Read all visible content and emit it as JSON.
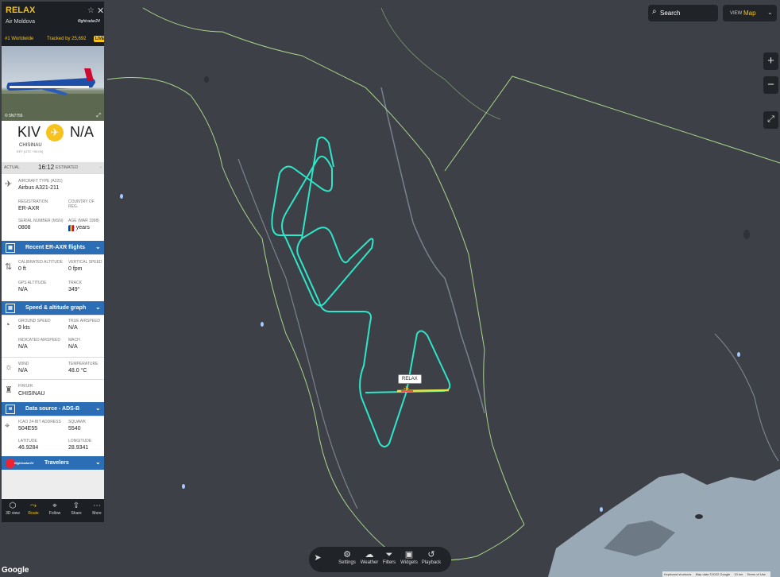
{
  "panel": {
    "callsign": "RELAX",
    "airline": "Air Moldova",
    "brand": "flightradar24",
    "rank": "#1 Worldwide",
    "tracked": "Tracked by 25,692",
    "live_badge": "LIVE",
    "photo_credit": "© 5N7756",
    "origin_code": "KIV",
    "dest_code": "N/A",
    "origin_city": "CHISINAU",
    "origin_tz": "EET (UTC +02:00)",
    "actual_label": "ACTUAL",
    "actual_time": "16:12",
    "estimated_label": "ESTIMATED",
    "estimated_value": "-",
    "aircraft_type_label": "AIRCRAFT TYPE (A321)",
    "aircraft_type": "Airbus A321-211",
    "registration_label": "REGISTRATION",
    "registration": "ER-AXR",
    "country_label": "COUNTRY OF REG.",
    "serial_label": "SERIAL NUMBER (MSN)",
    "serial": "0808",
    "age_label": "AGE (MAR 1998)",
    "age": "23 years",
    "recent_flights": "Recent ER-AXR flights",
    "cal_alt_label": "CALIBRATED ALTITUDE",
    "cal_alt": "0 ft",
    "vspeed_label": "VERTICAL SPEED",
    "vspeed": "0 fpm",
    "gps_alt_label": "GPS ALTITUDE",
    "gps_alt": "N/A",
    "track_label": "TRACK",
    "track": "349°",
    "speed_graph": "Speed & altitude graph",
    "gspeed_label": "GROUND SPEED",
    "gspeed": "9 kts",
    "tas_label": "TRUE AIRSPEED",
    "tas": "N/A",
    "ias_label": "INDICATED AIRSPEED",
    "ias": "N/A",
    "mach_label": "MACH",
    "mach": "N/A",
    "wind_label": "WIND",
    "wind": "N/A",
    "temp_label": "TEMPERATURE",
    "temp": "48.0 °C",
    "fir_label": "FIR/UIR",
    "fir": "CHISINAU",
    "data_source": "Data source - ADS-B",
    "icao_label": "ICAO 24-BIT ADDRESS",
    "icao": "504E55",
    "squawk_label": "SQUAWK",
    "squawk": "5540",
    "lat_label": "LATITUDE",
    "lat": "46.9284",
    "lon_label": "LONGITUDE",
    "lon": "28.9341",
    "travelers_brand": "flightradar24",
    "travelers": "Travelers"
  },
  "panel_tools": [
    "3D view",
    "Route",
    "Follow",
    "Share",
    "More"
  ],
  "search": {
    "label": "Search"
  },
  "view": {
    "key": "VIEW",
    "value": "Map"
  },
  "zoom": {
    "in": "+",
    "out": "−"
  },
  "bottom_toolbar": [
    "Settings",
    "Weather",
    "Filters",
    "Widgets",
    "Playback"
  ],
  "map": {
    "aircraft_label": "RELAX",
    "google": "Google",
    "footer": [
      "Keyboard shortcuts",
      "Map data ©2022 Google",
      "10 km",
      "Terms of Use"
    ]
  },
  "colors": {
    "accent": "#f6c21b",
    "track": "#2ee6c8",
    "border": "#a9d48a",
    "water": "#9aa9b6"
  }
}
